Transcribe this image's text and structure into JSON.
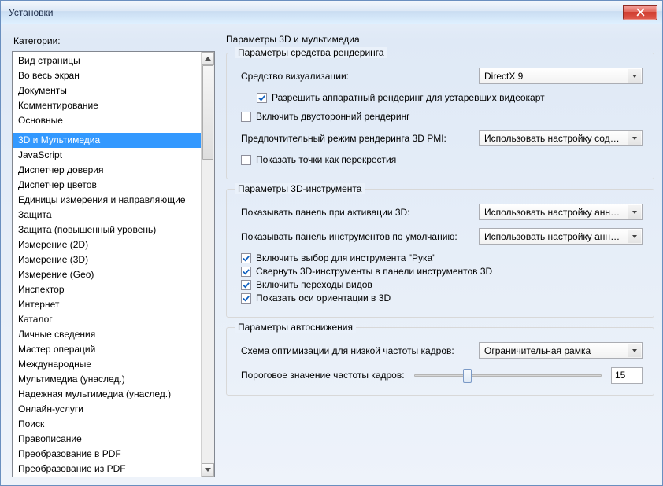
{
  "window": {
    "title": "Установки"
  },
  "sidebar": {
    "label": "Категории:",
    "items": [
      "Вид страницы",
      "Во весь экран",
      "Документы",
      "Комментирование",
      "Основные",
      "-",
      "3D и Мультимедиа",
      "JavaScript",
      "Диспетчер доверия",
      "Диспетчер цветов",
      "Единицы измерения и направляющие",
      "Защита",
      "Защита (повышенный уровень)",
      "Измерение (2D)",
      "Измерение (3D)",
      "Измерение (Geo)",
      "Инспектор",
      "Интернет",
      "Каталог",
      "Личные сведения",
      "Мастер операций",
      "Международные",
      "Мультимедиа (унаслед.)",
      "Надежная мультимедиа (унаслед.)",
      "Онлайн-услуги",
      "Поиск",
      "Правописание",
      "Преобразование в PDF",
      "Преобразование из PDF"
    ],
    "selected_index": 6
  },
  "panel": {
    "title": "Параметры 3D и мультимедиа",
    "group_render": {
      "title": "Параметры средства рендеринга",
      "renderer_label": "Средство визуализации:",
      "renderer_value": "DirectX 9",
      "legacy_hw_label": "Разрешить аппаратный рендеринг для устаревших видеокарт",
      "legacy_hw_checked": true,
      "two_sided_label": "Включить двусторонний рендеринг",
      "two_sided_checked": false,
      "pmi_label": "Предпочтительный режим рендеринга 3D PMI:",
      "pmi_value": "Использовать настройку содержимого",
      "crosshair_label": "Показать точки как перекрестия",
      "crosshair_checked": false
    },
    "group_tool": {
      "title": "Параметры 3D-инструмента",
      "panel_on_activate_label": "Показывать панель при активации 3D:",
      "panel_on_activate_value": "Использовать настройку аннотаций",
      "default_toolbar_label": "Показывать панель инструментов по умолчанию:",
      "default_toolbar_value": "Использовать настройку аннотаций",
      "hand_select_label": "Включить выбор для инструмента \"Рука\"",
      "hand_select_checked": true,
      "collapse_label": "Свернуть 3D-инструменты в панели инструментов 3D",
      "collapse_checked": true,
      "transitions_label": "Включить переходы видов",
      "transitions_checked": true,
      "axes_label": "Показать оси ориентации в 3D",
      "axes_checked": true
    },
    "group_degrade": {
      "title": "Параметры автоснижения",
      "scheme_label": "Схема оптимизации для низкой частоты кадров:",
      "scheme_value": "Ограничительная рамка",
      "threshold_label": "Пороговое значение частоты кадров:",
      "threshold_value": "15"
    }
  }
}
